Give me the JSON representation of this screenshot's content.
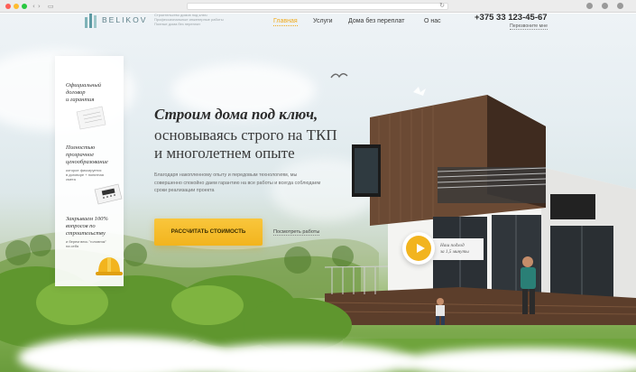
{
  "header": {
    "logo_text": "BELIKOV",
    "tagline": [
      "Строительство домов под ключ",
      "Профессиональные инженерные работы",
      "Полные дома без переплат"
    ],
    "nav": [
      {
        "label": "Главная",
        "active": true
      },
      {
        "label": "Услуги",
        "active": false
      },
      {
        "label": "Дома без переплат",
        "active": false
      },
      {
        "label": "О нас",
        "active": false
      }
    ],
    "phone": "+375 33 123-45-67",
    "callback_label": "Перезвоните мне"
  },
  "card": {
    "items": [
      {
        "title": [
          "Официальный",
          "договор",
          "и гарантия"
        ],
        "sub": []
      },
      {
        "title": [
          "Полностью",
          "прозрачное",
          "ценообразование"
        ],
        "sub": [
          "которое фиксируется",
          "в договоре + понятная",
          "смета"
        ]
      },
      {
        "title": [
          "Закрываем 100%",
          "вопросов по",
          "строительству"
        ],
        "sub": [
          "и берем весь \"головняк\"",
          "на себя"
        ]
      }
    ]
  },
  "hero": {
    "headline": "Строим дома под ключ,",
    "subline": [
      "основываясь строго на ТКП",
      "и многолетнем опыте"
    ],
    "description": "Благодаря накопленному опыту и передовым технологиям, мы совершенно спокойно даем гарантию на все работы и всегда соблюдаем сроки реализации проекта",
    "cta_label": "РАССЧИТАТЬ СТОИМОСТЬ",
    "portfolio_label": "Посмотреть работы",
    "video_caption": [
      "Наш подход",
      "за 1,5 минуты"
    ]
  },
  "colors": {
    "accent": "#f2b41e",
    "active_nav": "#f0a919",
    "text_dark": "#2b2b2b"
  }
}
